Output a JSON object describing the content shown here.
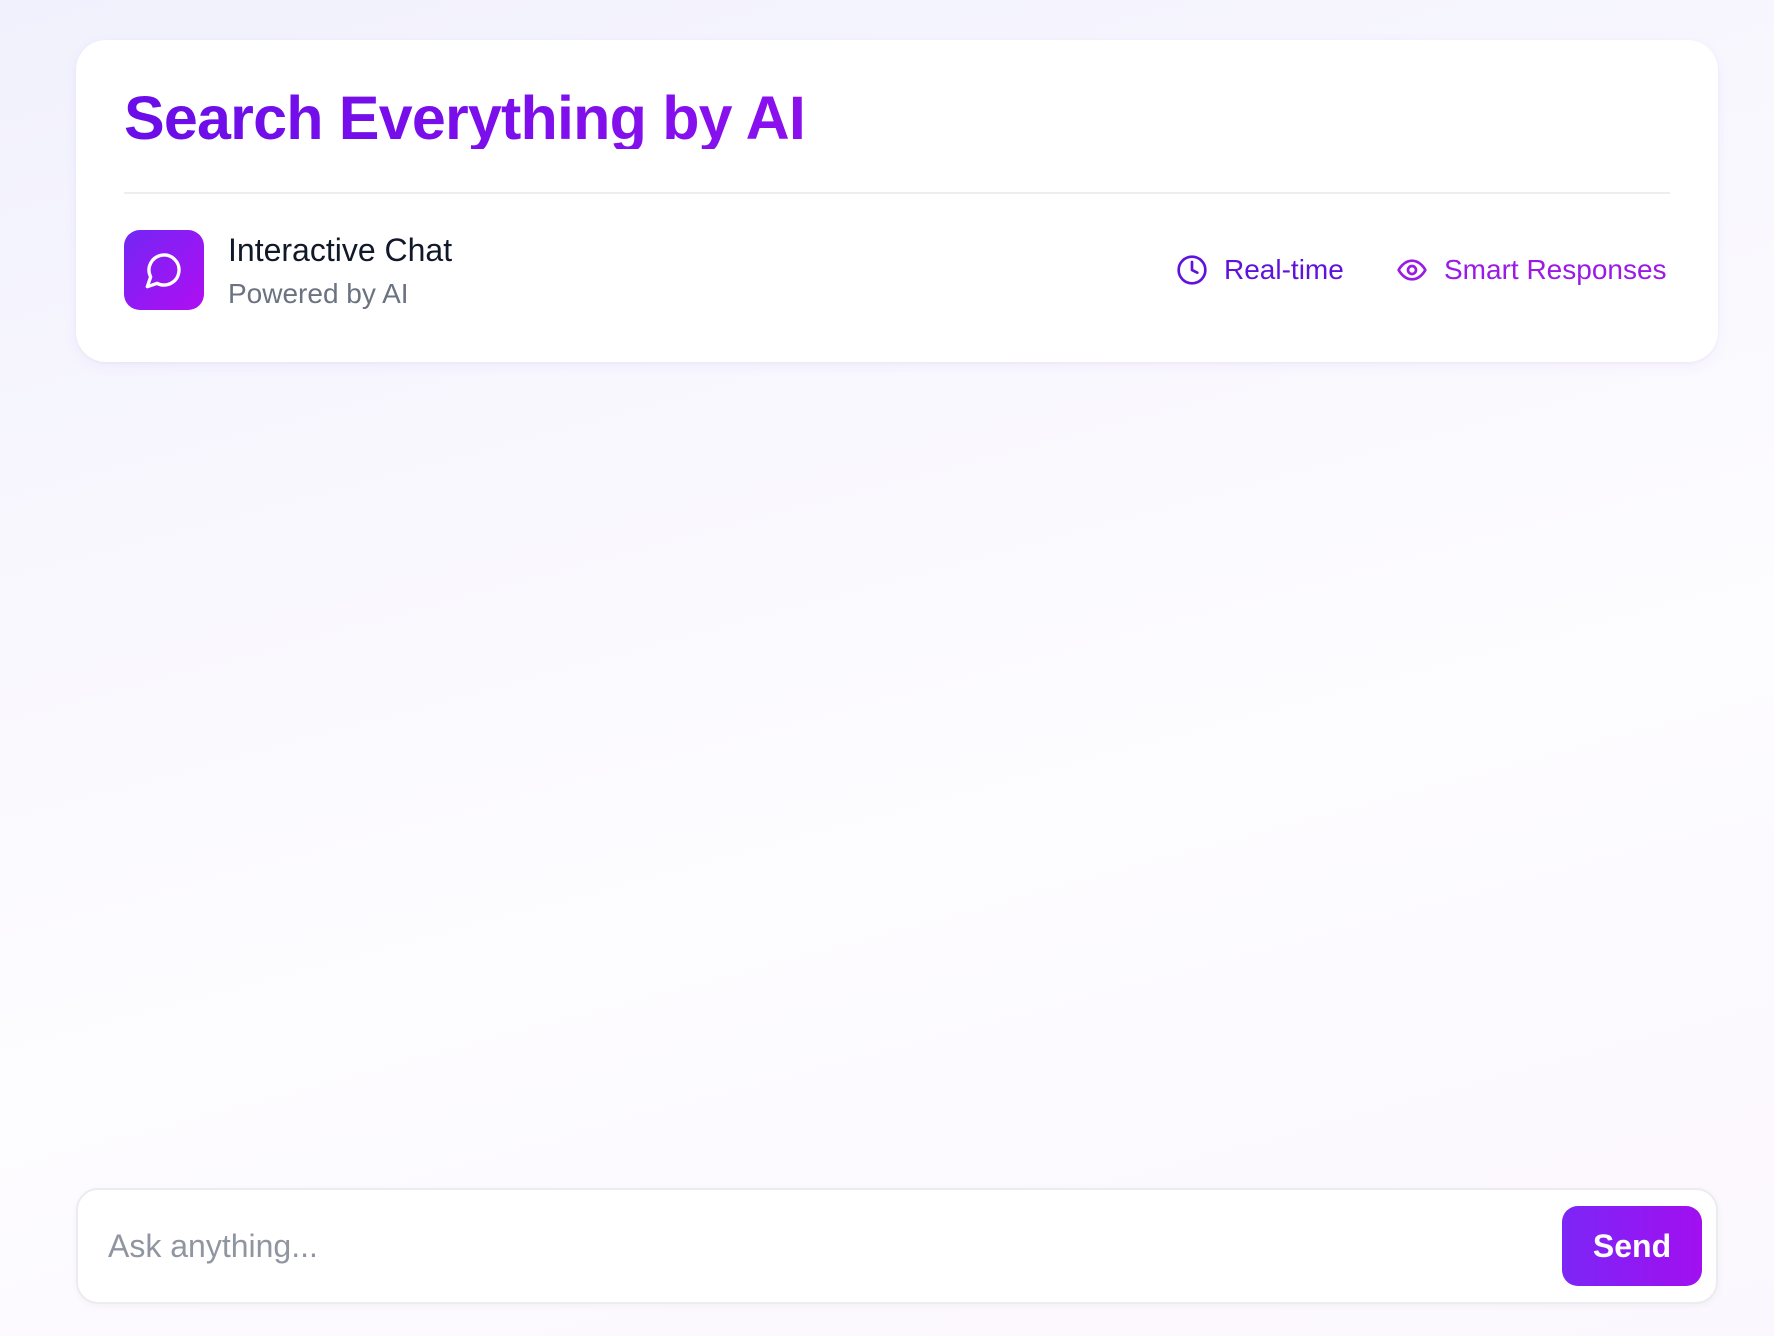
{
  "header": {
    "title": "Search Everything by AI",
    "chat_card": {
      "icon": "chat-bubble-icon",
      "title": "Interactive Chat",
      "subtitle": "Powered by AI"
    },
    "features": [
      {
        "icon": "clock-icon",
        "label": "Real-time",
        "color": "#5e12dc"
      },
      {
        "icon": "eye-icon",
        "label": "Smart Responses",
        "color": "#9a1ae6"
      }
    ]
  },
  "composer": {
    "input_value": "",
    "input_placeholder": "Ask anything...",
    "send_label": "Send"
  },
  "colors": {
    "accent_start": "#6a0de8",
    "accent_end": "#a10ff0"
  }
}
